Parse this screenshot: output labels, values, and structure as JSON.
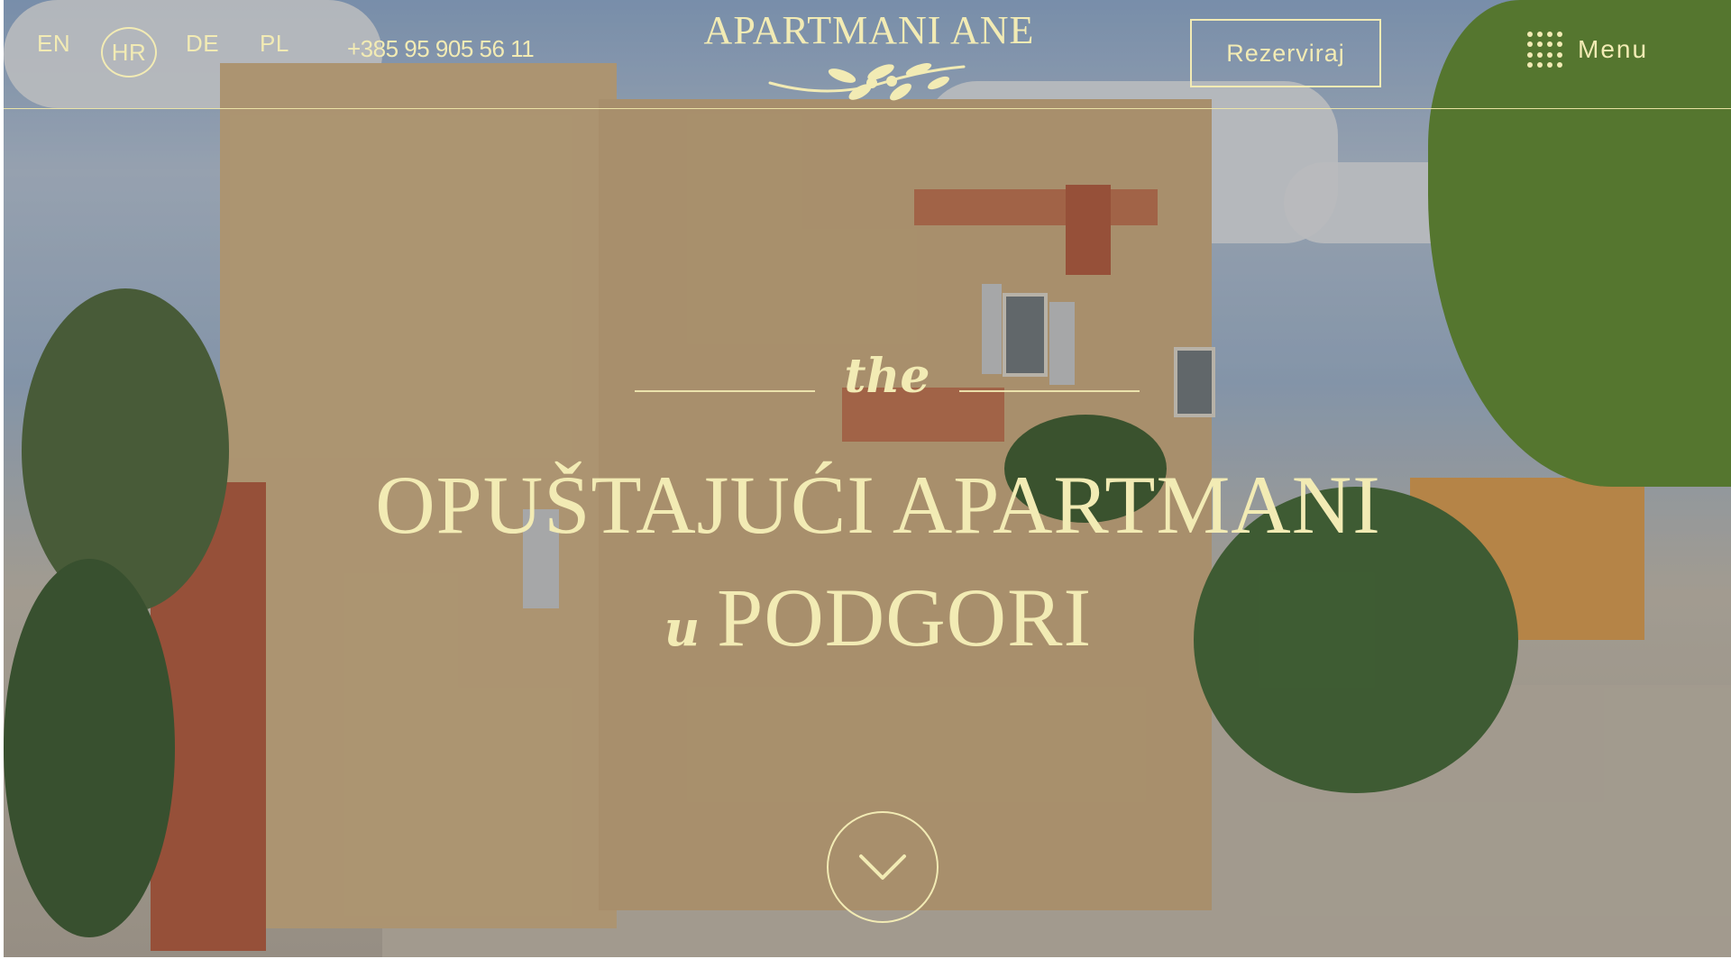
{
  "languages": [
    "EN",
    "HR",
    "DE",
    "PL"
  ],
  "active_language": "HR",
  "phone": "+385 95 905 56 11",
  "logo": {
    "text": "APARTMANI ANE"
  },
  "actions": {
    "reserve_label": "Rezerviraj",
    "menu_label": "Menu"
  },
  "hero": {
    "kicker": "the",
    "title_line1": "OPUŠTAJUĆI APARTMANI",
    "title_line2_prefix": "u",
    "title_line2": "PODGORI"
  },
  "icons": {
    "menu": "grid-dots-icon",
    "logo_mark": "olive-branch-icon",
    "scroll": "chevron-down-icon"
  },
  "colors": {
    "accent": "#f2ebb4"
  }
}
